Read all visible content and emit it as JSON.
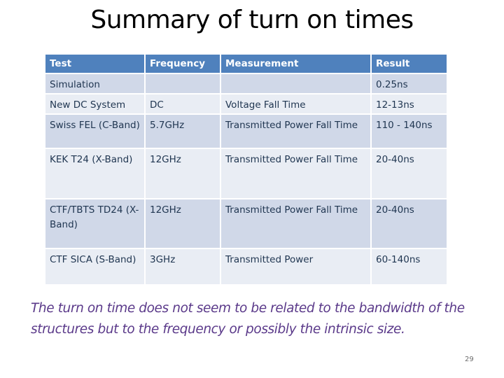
{
  "slide": {
    "title": "Summary of turn on times",
    "page_number": "29",
    "note": "The turn on time does not seem to be related to the bandwidth of the structures but to the frequency or possibly the intrinsic size."
  },
  "table": {
    "headers": [
      "Test",
      "Frequency",
      "Measurement",
      "Result"
    ],
    "rows": [
      [
        "Simulation",
        "",
        "",
        "0.25ns"
      ],
      [
        "New DC System",
        "DC",
        "Voltage Fall Time",
        "12-13ns"
      ],
      [
        "Swiss FEL (C-Band)",
        "5.7GHz",
        "Transmitted Power Fall Time",
        "110 - 140ns"
      ],
      [
        "KEK T24 (X-Band)",
        "12GHz",
        "Transmitted Power Fall Time",
        "20-40ns"
      ],
      [
        "CTF/TBTS TD24 (X-Band)",
        "12GHz",
        "Transmitted Power Fall Time",
        "20-40ns"
      ],
      [
        "CTF SICA (S-Band)",
        "3GHz",
        "Transmitted Power",
        "60-140ns"
      ]
    ]
  },
  "colors": {
    "header_bg": "#4f81bd",
    "row_dark": "#d0d8e8",
    "row_light": "#e9edf4",
    "note_text": "#5b3a8a"
  }
}
